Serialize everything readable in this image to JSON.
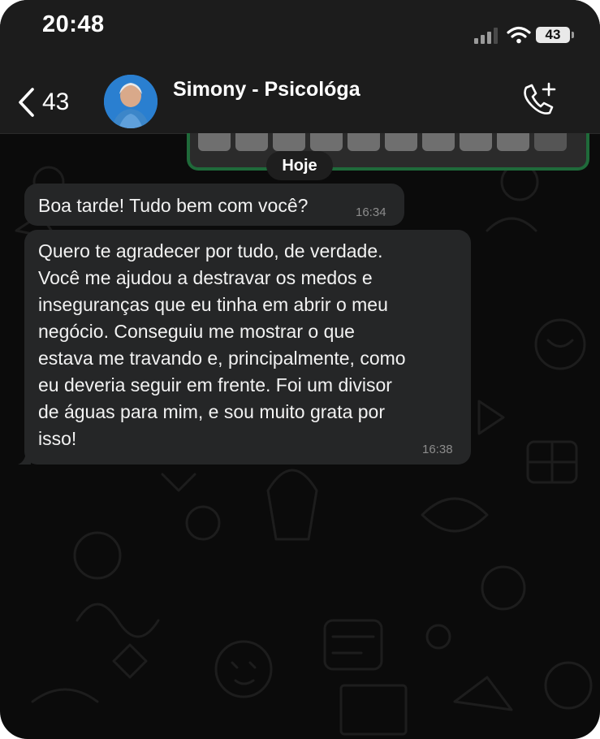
{
  "status_bar": {
    "time": "20:48",
    "battery": "43"
  },
  "header": {
    "back_count": "43",
    "contact_name": "Simony - Psicológa"
  },
  "chat": {
    "date_label": "Hoje",
    "messages": [
      {
        "text": "Boa tarde! Tudo bem com você?",
        "time": "16:34"
      },
      {
        "text": "Quero te agradecer por tudo, de verdade.\nVocê me ajudou a destravar os medos e\ninseguranças que eu tinha em abrir o meu\nnegócio. Conseguiu me mostrar o que\nestava me travando e, principalmente, como\neu deveria seguir em frente. Foi um divisor\nde águas para mim, e sou muito grata por\nisso!",
        "time": "16:38"
      }
    ]
  },
  "colors": {
    "background": "#0b0b0b",
    "bubble": "#252627",
    "header": "#1c1c1c",
    "quoted_border": "#1f6a3a"
  },
  "icons": [
    "signal-icon",
    "wifi-icon",
    "battery-icon",
    "back-chevron-icon",
    "call-add-icon"
  ]
}
